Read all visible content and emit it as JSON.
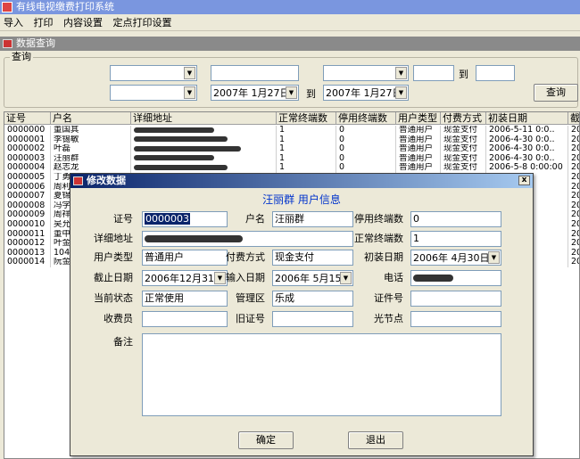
{
  "app": {
    "title": "有线电视缴费打印系统"
  },
  "menu": [
    "导入",
    "打印",
    "内容设置",
    "定点打印设置"
  ],
  "child_window": {
    "title": "数据查询"
  },
  "query": {
    "group_label": "查询",
    "to1": "到",
    "to2": "到",
    "date_from": "2007年 1月27日",
    "date_to": "2007年 1月27日",
    "button": "查询"
  },
  "grid": {
    "headers": [
      "证号",
      "户名",
      "详细地址",
      "正常终端数",
      "停用终端数",
      "用户类型",
      "付费方式",
      "初装日期",
      "截"
    ],
    "rows": [
      {
        "id": "0000000",
        "name": "董国其",
        "normal": "1",
        "stop": "0",
        "type": "普通用户",
        "pay": "现金支付",
        "date": "2006-5-11 0:0..",
        "cut": "20"
      },
      {
        "id": "0000001",
        "name": "李锡敏",
        "normal": "1",
        "stop": "0",
        "type": "普通用户",
        "pay": "现金支付",
        "date": "2006-4-30 0:0..",
        "cut": "20"
      },
      {
        "id": "0000002",
        "name": "叶磊",
        "normal": "1",
        "stop": "0",
        "type": "普通用户",
        "pay": "现金支付",
        "date": "2006-4-30 0:0..",
        "cut": "20"
      },
      {
        "id": "0000003",
        "name": "汪丽群",
        "normal": "1",
        "stop": "0",
        "type": "普通用户",
        "pay": "现金支付",
        "date": "2006-4-30 0:0..",
        "cut": "20"
      },
      {
        "id": "0000004",
        "name": "赵志龙",
        "normal": "1",
        "stop": "0",
        "type": "普通用户",
        "pay": "现金支付",
        "date": "2006-5-8 0:00:00",
        "cut": "20"
      },
      {
        "id": "0000005",
        "name": "丁勇",
        "normal": "",
        "stop": "",
        "type": "",
        "pay": "",
        "date": "0:00:00",
        "cut": "20"
      },
      {
        "id": "0000006",
        "name": "周利",
        "normal": "",
        "stop": "",
        "type": "",
        "pay": "",
        "date": "0:00:00",
        "cut": "20"
      },
      {
        "id": "0000007",
        "name": "夏锦",
        "normal": "",
        "stop": "",
        "type": "",
        "pay": "",
        "date": "0:00:00",
        "cut": "20"
      },
      {
        "id": "0000008",
        "name": "冯学",
        "normal": "",
        "stop": "",
        "type": "",
        "pay": "",
        "date": "0:0..",
        "cut": "20"
      },
      {
        "id": "0000009",
        "name": "周祥",
        "normal": "",
        "stop": "",
        "type": "",
        "pay": "",
        "date": "0:0..",
        "cut": "20"
      },
      {
        "id": "0000010",
        "name": "吴允",
        "normal": "",
        "stop": "",
        "type": "",
        "pay": "",
        "date": "0:0..",
        "cut": "20"
      },
      {
        "id": "0000011",
        "name": "董中",
        "normal": "",
        "stop": "",
        "type": "",
        "pay": "",
        "date": "0:00:00",
        "cut": "20"
      },
      {
        "id": "0000012",
        "name": "叶金",
        "normal": "",
        "stop": "",
        "type": "",
        "pay": "",
        "date": "0:0..",
        "cut": "20"
      },
      {
        "id": "0000013",
        "name": "104",
        "normal": "",
        "stop": "",
        "type": "",
        "pay": "",
        "date": "0:00:00",
        "cut": "20"
      },
      {
        "id": "0000014",
        "name": "阮金",
        "normal": "",
        "stop": "",
        "type": "",
        "pay": "",
        "date": "0:00:00",
        "cut": "20"
      }
    ]
  },
  "dialog": {
    "title": "修改数据",
    "close": "x",
    "heading": "汪丽群 用户信息",
    "labels": {
      "id": "证号",
      "name": "户名",
      "stop_terms": "停用终端数",
      "address": "详细地址",
      "normal_terms": "正常终端数",
      "user_type": "用户类型",
      "pay_method": "付费方式",
      "install_date": "初装日期",
      "cutoff_date": "截止日期",
      "input_date": "输入日期",
      "phone": "电话",
      "status": "当前状态",
      "district": "管理区",
      "cert_no": "证件号",
      "collector": "收费员",
      "old_id": "旧证号",
      "node": "光节点",
      "remark": "备注"
    },
    "values": {
      "id": "0000003",
      "name": "汪丽群",
      "stop_terms": "0",
      "normal_terms": "1",
      "user_type": "普通用户",
      "pay_method": "现金支付",
      "install_date": "2006年 4月30日",
      "cutoff_date": "2006年12月31日",
      "input_date": "2006年 5月15日",
      "status": "正常使用",
      "district": "乐成",
      "cert_no": "",
      "collector": "",
      "old_id": "",
      "node": "",
      "remark": ""
    },
    "ok": "确定",
    "exit": "退出"
  }
}
